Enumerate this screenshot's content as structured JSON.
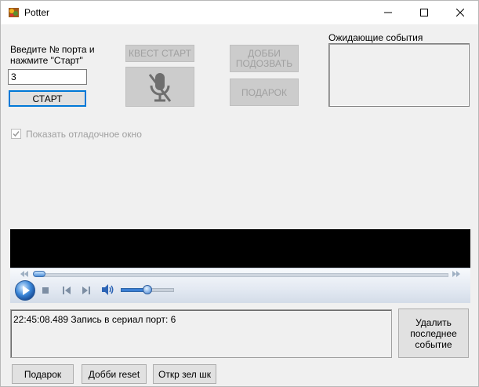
{
  "window": {
    "title": "Potter"
  },
  "left_panel": {
    "port_label": "Введите № порта и нажмите \"Старт\"",
    "port_value": "3",
    "start_label": "СТАРТ",
    "debug_checkbox_label": "Показать отладочное окно",
    "debug_checked": true
  },
  "buttons": {
    "quest_start": "КВЕСТ СТАРТ",
    "dobbi_call": "ДОББИ ПОДОЗВАТЬ",
    "gift_big": "ПОДАРОК",
    "delete_last": "Удалить последнее событие",
    "gift": "Подарок",
    "dobbi_reset": "Добби reset",
    "open_green": "Откр зел шк"
  },
  "events": {
    "label": "Ожидающие события"
  },
  "log": {
    "text": "22:45:08.489 Запись в сериал порт: 6"
  },
  "player": {
    "seek_position": 0.04,
    "volume": 0.5
  },
  "colors": {
    "accent": "#0078d7",
    "window_bg": "#f0f0f0",
    "disabled_text": "#a0a0a0"
  },
  "icons": {
    "app": "potter-app-icon",
    "mic": "microphone-muted-icon",
    "play": "play-icon",
    "stop": "stop-icon",
    "prev": "previous-icon",
    "next": "next-icon",
    "volume": "speaker-icon"
  }
}
